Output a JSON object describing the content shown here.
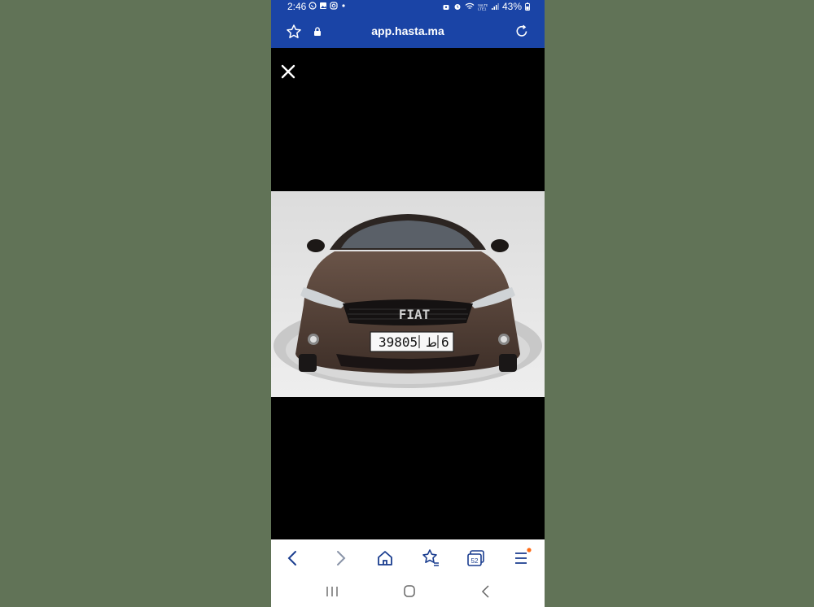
{
  "status_bar": {
    "time": "2:46",
    "battery": "43%",
    "left_icons": [
      "whatsapp-icon",
      "gallery-icon",
      "instagram-icon",
      "dot-icon"
    ],
    "right_icons": [
      "privacy-icon",
      "alarm-icon",
      "wifi-icon",
      "volte-icon",
      "signal-icon",
      "battery-icon"
    ]
  },
  "browser": {
    "url": "app.hasta.ma",
    "left_icons": [
      "star-icon",
      "lock-icon"
    ],
    "right_icon": "reload-icon"
  },
  "viewer": {
    "close_icon": "close-icon",
    "photo": {
      "subject": "brown Fiat hatchback front view",
      "brand_badge": "FIAT",
      "plate_number": "39805",
      "plate_arabic": "ط",
      "plate_region": "6"
    }
  },
  "bottom_nav": {
    "icons": [
      "back-icon",
      "forward-icon",
      "home-icon",
      "bookmarks-icon",
      "tabs-icon",
      "menu-icon"
    ],
    "tabs_count": "52"
  },
  "system_nav": {
    "icons": [
      "recent-apps-icon",
      "home-circle-icon",
      "system-back-icon"
    ]
  },
  "colors": {
    "page_background": "#617357",
    "browser_bar": "#1a44a6",
    "viewer_background": "#000000",
    "nav_icon": "#1a3d8f",
    "menu_dot": "#ff6a13"
  }
}
